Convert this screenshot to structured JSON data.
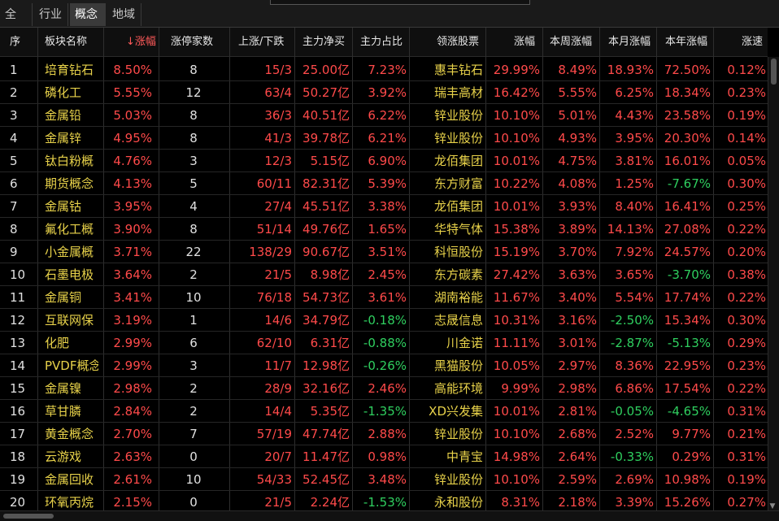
{
  "tabs": [
    "全部",
    "行业",
    "概念",
    "地域"
  ],
  "active_tab": 2,
  "columns": {
    "idx": "序",
    "name": "板块名称",
    "chg": "涨幅",
    "lim": "涨停家数",
    "ud": "上涨/下跌",
    "net": "主力净买",
    "ratio": "主力占比",
    "lead": "领涨股票",
    "lchg": "涨幅",
    "wk": "本周涨幅",
    "mo": "本月涨幅",
    "yr": "本年涨幅",
    "spd": "涨速"
  },
  "sort_marker": "↓",
  "colors": {
    "up": "#ff4a4a",
    "down": "#2fcf5f",
    "name": "#e8d24a"
  },
  "rows": [
    {
      "idx": "1",
      "name": "培育钻石",
      "chg": "8.50%",
      "lim": "8",
      "ud": "15/3",
      "net": "25.00亿",
      "ratio": "7.23%",
      "lead": "惠丰钻石",
      "lchg": "29.99%",
      "wk": "8.49%",
      "mo": "18.93%",
      "yr": "72.50%",
      "spd": "0.12%"
    },
    {
      "idx": "2",
      "name": "磷化工",
      "chg": "5.55%",
      "lim": "12",
      "ud": "63/4",
      "net": "50.27亿",
      "ratio": "3.92%",
      "lead": "瑞丰高材",
      "lchg": "16.42%",
      "wk": "5.55%",
      "mo": "6.25%",
      "yr": "18.34%",
      "spd": "0.23%"
    },
    {
      "idx": "3",
      "name": "金属铅",
      "chg": "5.03%",
      "lim": "8",
      "ud": "36/3",
      "net": "40.51亿",
      "ratio": "6.22%",
      "lead": "锌业股份",
      "lchg": "10.10%",
      "wk": "5.01%",
      "mo": "4.43%",
      "yr": "23.58%",
      "spd": "0.19%"
    },
    {
      "idx": "4",
      "name": "金属锌",
      "chg": "4.95%",
      "lim": "8",
      "ud": "41/3",
      "net": "39.78亿",
      "ratio": "6.21%",
      "lead": "锌业股份",
      "lchg": "10.10%",
      "wk": "4.93%",
      "mo": "3.95%",
      "yr": "20.30%",
      "spd": "0.14%"
    },
    {
      "idx": "5",
      "name": "钛白粉概",
      "chg": "4.76%",
      "lim": "3",
      "ud": "12/3",
      "net": "5.15亿",
      "ratio": "6.90%",
      "lead": "龙佰集团",
      "lchg": "10.01%",
      "wk": "4.75%",
      "mo": "3.81%",
      "yr": "16.01%",
      "spd": "0.05%"
    },
    {
      "idx": "6",
      "name": "期货概念",
      "chg": "4.13%",
      "lim": "5",
      "ud": "60/11",
      "net": "82.31亿",
      "ratio": "5.39%",
      "lead": "东方财富",
      "lchg": "10.22%",
      "wk": "4.08%",
      "mo": "1.25%",
      "yr": "-7.67%",
      "spd": "0.30%"
    },
    {
      "idx": "7",
      "name": "金属钴",
      "chg": "3.95%",
      "lim": "4",
      "ud": "27/4",
      "net": "45.51亿",
      "ratio": "3.38%",
      "lead": "龙佰集团",
      "lchg": "10.01%",
      "wk": "3.93%",
      "mo": "8.40%",
      "yr": "16.41%",
      "spd": "0.25%"
    },
    {
      "idx": "8",
      "name": "氟化工概",
      "chg": "3.90%",
      "lim": "8",
      "ud": "51/14",
      "net": "49.76亿",
      "ratio": "1.65%",
      "lead": "华特气体",
      "lchg": "15.38%",
      "wk": "3.89%",
      "mo": "14.13%",
      "yr": "27.08%",
      "spd": "0.22%"
    },
    {
      "idx": "9",
      "name": "小金属概",
      "chg": "3.71%",
      "lim": "22",
      "ud": "138/29",
      "net": "90.67亿",
      "ratio": "3.51%",
      "lead": "科恒股份",
      "lchg": "15.19%",
      "wk": "3.70%",
      "mo": "7.92%",
      "yr": "24.57%",
      "spd": "0.20%"
    },
    {
      "idx": "10",
      "name": "石墨电极",
      "chg": "3.64%",
      "lim": "2",
      "ud": "21/5",
      "net": "8.98亿",
      "ratio": "2.45%",
      "lead": "东方碳素",
      "lchg": "27.42%",
      "wk": "3.63%",
      "mo": "3.65%",
      "yr": "-3.70%",
      "spd": "0.38%"
    },
    {
      "idx": "11",
      "name": "金属铜",
      "chg": "3.41%",
      "lim": "10",
      "ud": "76/18",
      "net": "54.73亿",
      "ratio": "3.61%",
      "lead": "湖南裕能",
      "lchg": "11.67%",
      "wk": "3.40%",
      "mo": "5.54%",
      "yr": "17.74%",
      "spd": "0.22%"
    },
    {
      "idx": "12",
      "name": "互联网保",
      "chg": "3.19%",
      "lim": "1",
      "ud": "14/6",
      "net": "34.79亿",
      "ratio": "-0.18%",
      "lead": "志晟信息",
      "lchg": "10.31%",
      "wk": "3.16%",
      "mo": "-2.50%",
      "yr": "15.34%",
      "spd": "0.30%"
    },
    {
      "idx": "13",
      "name": "化肥",
      "chg": "2.99%",
      "lim": "6",
      "ud": "62/10",
      "net": "6.31亿",
      "ratio": "-0.88%",
      "lead": "川金诺",
      "lchg": "11.11%",
      "wk": "3.01%",
      "mo": "-2.87%",
      "yr": "-5.13%",
      "spd": "0.29%"
    },
    {
      "idx": "14",
      "name": "PVDF概念",
      "chg": "2.99%",
      "lim": "3",
      "ud": "11/7",
      "net": "12.98亿",
      "ratio": "-0.26%",
      "lead": "黑猫股份",
      "lchg": "10.05%",
      "wk": "2.97%",
      "mo": "8.36%",
      "yr": "22.95%",
      "spd": "0.23%"
    },
    {
      "idx": "15",
      "name": "金属镍",
      "chg": "2.98%",
      "lim": "2",
      "ud": "28/9",
      "net": "32.16亿",
      "ratio": "2.46%",
      "lead": "高能环境",
      "lchg": "9.99%",
      "wk": "2.98%",
      "mo": "6.86%",
      "yr": "17.54%",
      "spd": "0.22%"
    },
    {
      "idx": "16",
      "name": "草甘膦",
      "chg": "2.84%",
      "lim": "2",
      "ud": "14/4",
      "net": "5.35亿",
      "ratio": "-1.35%",
      "lead": "XD兴发集",
      "lchg": "10.01%",
      "wk": "2.81%",
      "mo": "-0.05%",
      "yr": "-4.65%",
      "spd": "0.31%"
    },
    {
      "idx": "17",
      "name": "黄金概念",
      "chg": "2.70%",
      "lim": "7",
      "ud": "57/19",
      "net": "47.74亿",
      "ratio": "2.88%",
      "lead": "锌业股份",
      "lchg": "10.10%",
      "wk": "2.68%",
      "mo": "2.52%",
      "yr": "9.77%",
      "spd": "0.21%"
    },
    {
      "idx": "18",
      "name": "云游戏",
      "chg": "2.63%",
      "lim": "0",
      "ud": "20/7",
      "net": "11.47亿",
      "ratio": "0.98%",
      "lead": "中青宝",
      "lchg": "14.98%",
      "wk": "2.64%",
      "mo": "-0.33%",
      "yr": "0.29%",
      "spd": "0.31%"
    },
    {
      "idx": "19",
      "name": "金属回收",
      "chg": "2.61%",
      "lim": "10",
      "ud": "54/33",
      "net": "52.45亿",
      "ratio": "3.48%",
      "lead": "锌业股份",
      "lchg": "10.10%",
      "wk": "2.59%",
      "mo": "2.69%",
      "yr": "10.98%",
      "spd": "0.19%"
    },
    {
      "idx": "20",
      "name": "环氧丙烷",
      "chg": "2.15%",
      "lim": "0",
      "ud": "21/5",
      "net": "2.24亿",
      "ratio": "-1.53%",
      "lead": "永和股份",
      "lchg": "8.31%",
      "wk": "2.18%",
      "mo": "3.39%",
      "yr": "15.26%",
      "spd": "0.27%"
    }
  ]
}
